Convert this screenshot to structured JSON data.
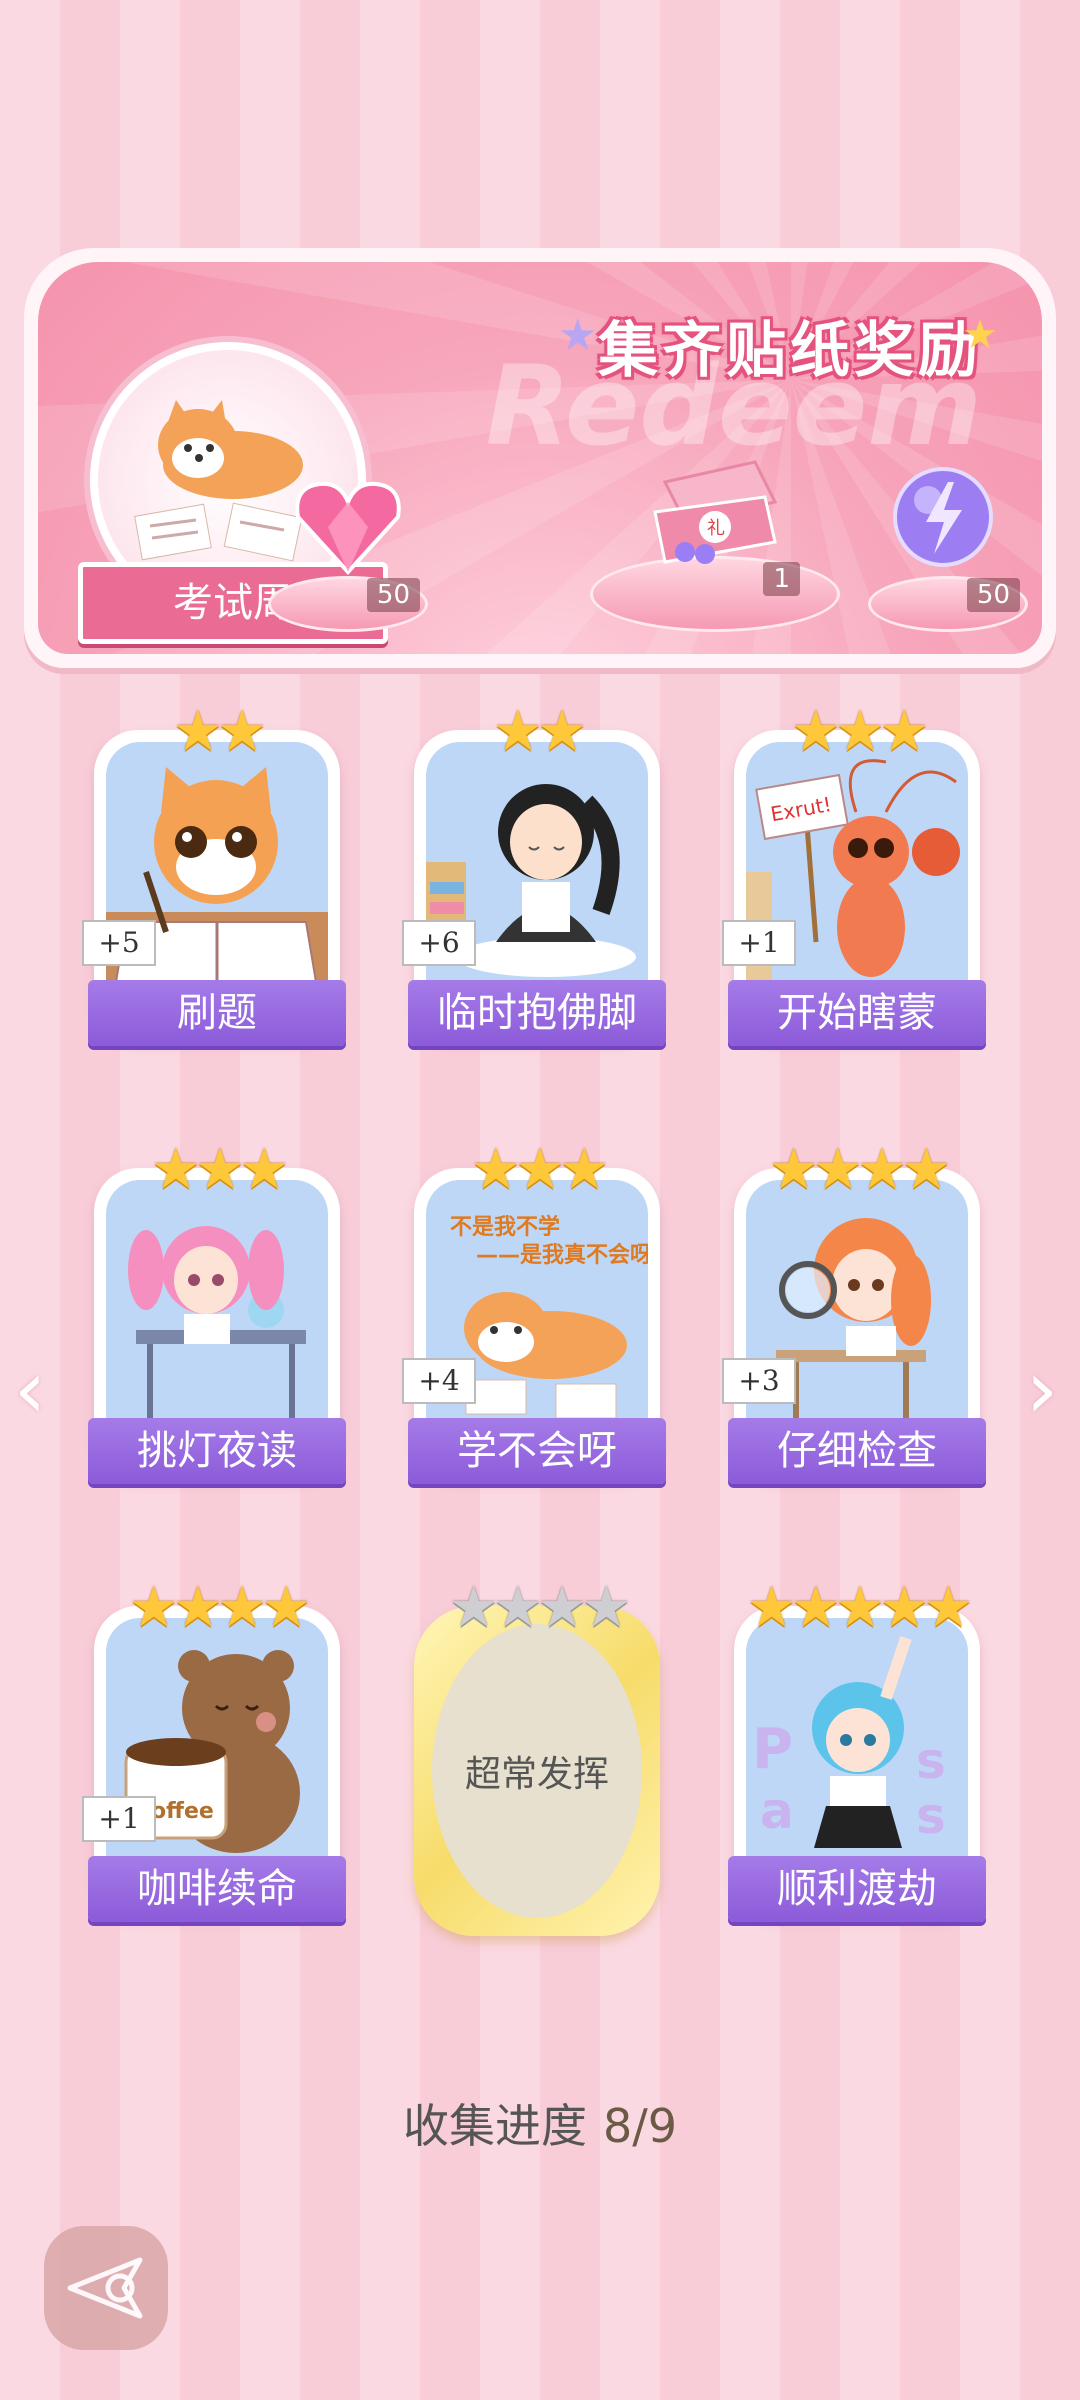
{
  "header": {
    "title": "集齐贴纸奖励",
    "watermark": "Redeem",
    "theme_name": "考试周"
  },
  "rewards": [
    {
      "icon": "pink-heart-gem-icon",
      "count": "50"
    },
    {
      "icon": "gift-box-icon",
      "count": "1"
    },
    {
      "icon": "lightning-orb-icon",
      "count": "50"
    }
  ],
  "stickers": [
    {
      "label": "刷题",
      "stars": "★★",
      "bonus": "+5",
      "icon": "cat-studying-icon",
      "art_bg": "#bfd7f6"
    },
    {
      "label": "临时抱佛脚",
      "stars": "★★",
      "bonus": "+6",
      "icon": "girl-reading-icon",
      "art_bg": "#c4dbf7"
    },
    {
      "label": "开始瞎蒙",
      "stars": "★★★",
      "bonus": "+1",
      "icon": "shrimp-sign-icon",
      "art_bg": "#c4dbf7",
      "sign_text": "Exrut!"
    },
    {
      "label": "挑灯夜读",
      "stars": "★★★",
      "bonus": "",
      "icon": "girl-desk-lamp-icon",
      "art_bg": "#c4dbf7"
    },
    {
      "label": "学不会呀",
      "stars": "★★★",
      "bonus": "+4",
      "icon": "shiba-lying-icon",
      "art_bg": "#c4dbf7",
      "caption": "不是我不学\n——是我真不会呀"
    },
    {
      "label": "仔细检查",
      "stars": "★★★★",
      "bonus": "+3",
      "icon": "girl-magnifier-icon",
      "art_bg": "#c4dbf7"
    },
    {
      "label": "咖啡续命",
      "stars": "★★★★",
      "bonus": "+1",
      "icon": "bear-coffee-icon",
      "art_bg": "#c4dbf7",
      "cup_text": "coffee"
    },
    {
      "label": "顺利渡劫",
      "stars": "★★★★★",
      "bonus": "",
      "icon": "girl-pass-icon",
      "art_bg": "#c4dbf7"
    }
  ],
  "locked_sticker": {
    "label": "超常发挥",
    "stars": "★★★★"
  },
  "progress": {
    "label": "收集进度",
    "value": "8/9"
  },
  "nav": {
    "prev": "‹",
    "next": "›"
  }
}
